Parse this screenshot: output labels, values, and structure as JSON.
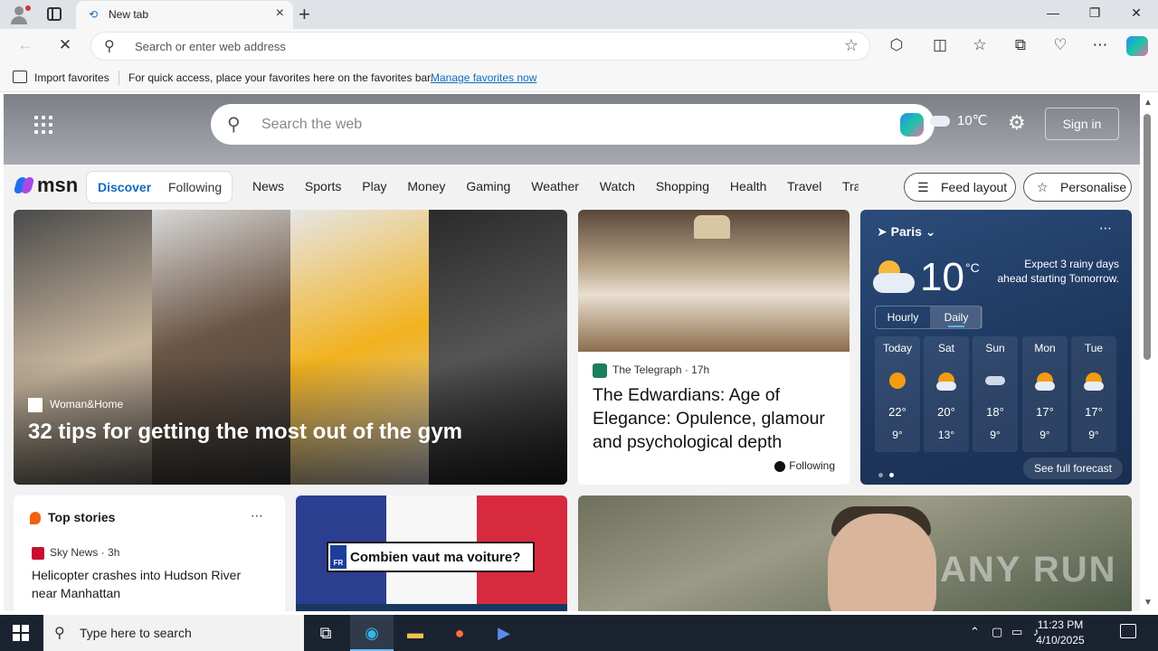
{
  "browser": {
    "tab_title": "New tab",
    "address_placeholder": "Search or enter web address",
    "favbar": {
      "import_label": "Import favorites",
      "message": "For quick access, place your favorites here on the favorites bar.",
      "manage_link": "Manage favorites now"
    }
  },
  "msn": {
    "search_placeholder": "Search the web",
    "header_temp": "10℃",
    "signin_label": "Sign in",
    "logo_text": "msn",
    "feed_tabs": [
      "Discover",
      "Following"
    ],
    "nav_links": [
      "News",
      "Sports",
      "Play",
      "Money",
      "Gaming",
      "Weather",
      "Watch",
      "Shopping",
      "Health",
      "Travel",
      "Tra"
    ],
    "feed_layout_label": "Feed layout",
    "personalise_label": "Personalise"
  },
  "cards": {
    "gym": {
      "source": "Woman&Home",
      "headline": "32 tips for getting the most out of the gym"
    },
    "telegraph": {
      "source": "The Telegraph",
      "time": "17h",
      "headline": "The Edwardians: Age of Elegance: Opulence, glamour and psychological depth",
      "following_label": "Following"
    },
    "weather": {
      "location": "Paris",
      "temp": "10",
      "unit": "°C",
      "summary": "Expect 3 rainy days ahead starting Tomorrow.",
      "toggle": [
        "Hourly",
        "Daily"
      ],
      "days": [
        {
          "name": "Today",
          "hi": "22°",
          "lo": "9°",
          "icon": "sun-icon"
        },
        {
          "name": "Sat",
          "hi": "20°",
          "lo": "13°",
          "icon": "partly-cloudy-icon"
        },
        {
          "name": "Sun",
          "hi": "18°",
          "lo": "9°",
          "icon": "rain-cloud-icon"
        },
        {
          "name": "Mon",
          "hi": "17°",
          "lo": "9°",
          "icon": "partly-cloudy-icon"
        },
        {
          "name": "Tue",
          "hi": "17°",
          "lo": "9°",
          "icon": "partly-cloudy-icon"
        }
      ],
      "forecast_label": "See full forecast"
    },
    "top_stories": {
      "title": "Top stories",
      "source": "Sky News",
      "time": "3h",
      "headline": "Helicopter crashes into Hudson River near Manhattan"
    },
    "ad": {
      "badge_code": "FR",
      "headline": "Combien vaut ma voiture?"
    },
    "watermark": "ANY RUN"
  },
  "taskbar": {
    "search_placeholder": "Type here to search",
    "time": "11:23 PM",
    "date": "4/10/2025"
  }
}
